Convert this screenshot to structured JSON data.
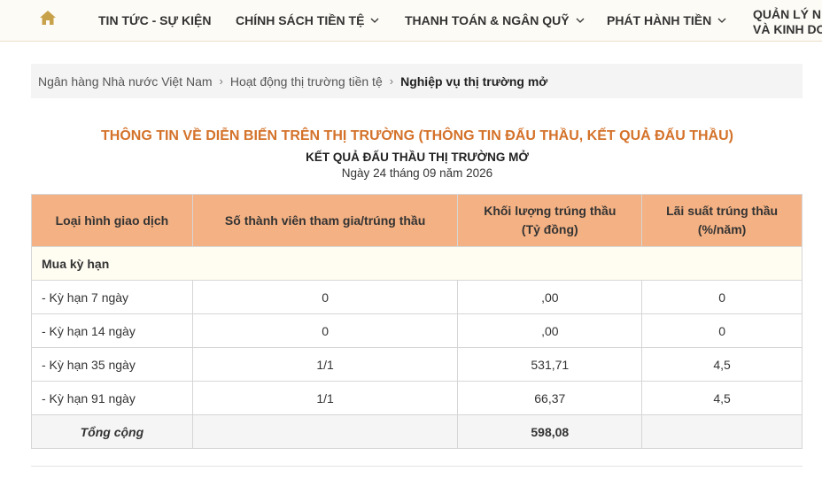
{
  "nav": {
    "items": [
      {
        "label": "TIN TỨC - SỰ KIỆN"
      },
      {
        "label": "CHÍNH SÁCH TIỀN TỆ"
      },
      {
        "label": "THANH TOÁN & NGÂN QUỸ"
      },
      {
        "label": "PHÁT HÀNH TIỀN"
      }
    ],
    "last_line1": "QUẢN LÝ N",
    "last_line2": "VÀ KINH DOA",
    "home_icon": "home-icon",
    "accent_color": "#c8a24a"
  },
  "breadcrumb": {
    "items": [
      "Ngân hàng Nhà nước Việt Nam",
      "Hoạt động thị trường tiền tệ"
    ],
    "current": "Nghiệp vụ thị trường mở"
  },
  "heading": {
    "title": "THÔNG TIN VỀ DIỄN BIẾN TRÊN THỊ TRƯỜNG (THÔNG TIN ĐẤU THẦU, KẾT QUẢ ĐẤU THẦU)",
    "subtitle": "KẾT QUẢ ĐẤU THẦU THỊ TRƯỜNG MỞ",
    "date": "Ngày 24 tháng 09 năm 2026",
    "title_color": "#d4722a"
  },
  "table": {
    "header_color": "#f4b183",
    "headers": [
      {
        "line1": "Loại hình giao dịch",
        "line2": ""
      },
      {
        "line1": "Số thành viên tham gia/trúng thầu",
        "line2": ""
      },
      {
        "line1": "Khối lượng trúng thầu",
        "line2": "(Tỷ đồng)"
      },
      {
        "line1": "Lãi suất trúng thầu",
        "line2": "(%/năm)"
      }
    ],
    "group_label": "Mua kỳ hạn",
    "rows": [
      [
        "- Kỳ hạn 7 ngày",
        "0",
        ",00",
        "0"
      ],
      [
        "- Kỳ hạn 14 ngày",
        "0",
        ",00",
        "0"
      ],
      [
        "- Kỳ hạn 35 ngày",
        "1/1",
        "531,71",
        "4,5"
      ],
      [
        "- Kỳ hạn 91 ngày",
        "1/1",
        "66,37",
        "4,5"
      ]
    ],
    "total": {
      "label": "Tổng cộng",
      "members": "",
      "volume": "598,08",
      "rate": ""
    }
  }
}
